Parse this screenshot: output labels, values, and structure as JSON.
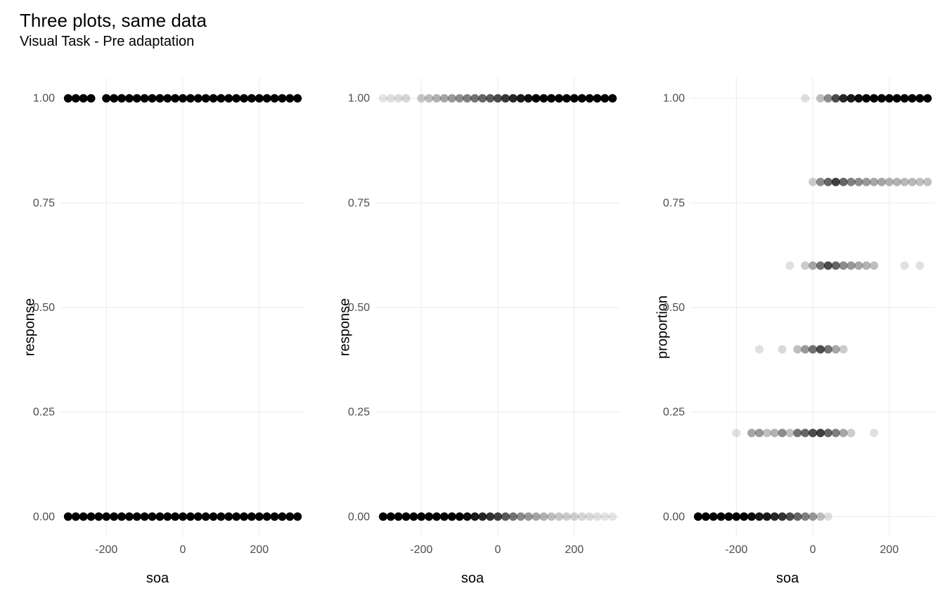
{
  "title": "Three plots, same data",
  "subtitle": "Visual Task - Pre adaptation",
  "chart_data": [
    {
      "type": "scatter",
      "xlabel": "soa",
      "ylabel": "response",
      "xlim": [
        -320,
        320
      ],
      "ylim": [
        -0.05,
        1.05
      ],
      "xticks": [
        -200,
        0,
        200
      ],
      "yticks": [
        0.0,
        0.25,
        0.5,
        0.75,
        1.0
      ],
      "ytick_labels": [
        "0.00",
        "0.25",
        "0.50",
        "0.75",
        "1.00"
      ],
      "opacity_scheme": "solid",
      "points": [
        {
          "x": -300,
          "y": 0
        },
        {
          "x": -280,
          "y": 0
        },
        {
          "x": -260,
          "y": 0
        },
        {
          "x": -240,
          "y": 0
        },
        {
          "x": -220,
          "y": 0
        },
        {
          "x": -200,
          "y": 0
        },
        {
          "x": -180,
          "y": 0
        },
        {
          "x": -160,
          "y": 0
        },
        {
          "x": -140,
          "y": 0
        },
        {
          "x": -120,
          "y": 0
        },
        {
          "x": -100,
          "y": 0
        },
        {
          "x": -80,
          "y": 0
        },
        {
          "x": -60,
          "y": 0
        },
        {
          "x": -40,
          "y": 0
        },
        {
          "x": -20,
          "y": 0
        },
        {
          "x": 0,
          "y": 0
        },
        {
          "x": 20,
          "y": 0
        },
        {
          "x": 40,
          "y": 0
        },
        {
          "x": 60,
          "y": 0
        },
        {
          "x": 80,
          "y": 0
        },
        {
          "x": 100,
          "y": 0
        },
        {
          "x": 120,
          "y": 0
        },
        {
          "x": 140,
          "y": 0
        },
        {
          "x": 160,
          "y": 0
        },
        {
          "x": 180,
          "y": 0
        },
        {
          "x": 200,
          "y": 0
        },
        {
          "x": 220,
          "y": 0
        },
        {
          "x": 240,
          "y": 0
        },
        {
          "x": 260,
          "y": 0
        },
        {
          "x": 280,
          "y": 0
        },
        {
          "x": 300,
          "y": 0
        },
        {
          "x": -300,
          "y": 1
        },
        {
          "x": -280,
          "y": 1
        },
        {
          "x": -260,
          "y": 1
        },
        {
          "x": -240,
          "y": 1
        },
        {
          "x": -200,
          "y": 1
        },
        {
          "x": -180,
          "y": 1
        },
        {
          "x": -160,
          "y": 1
        },
        {
          "x": -140,
          "y": 1
        },
        {
          "x": -120,
          "y": 1
        },
        {
          "x": -100,
          "y": 1
        },
        {
          "x": -80,
          "y": 1
        },
        {
          "x": -60,
          "y": 1
        },
        {
          "x": -40,
          "y": 1
        },
        {
          "x": -20,
          "y": 1
        },
        {
          "x": 0,
          "y": 1
        },
        {
          "x": 20,
          "y": 1
        },
        {
          "x": 40,
          "y": 1
        },
        {
          "x": 60,
          "y": 1
        },
        {
          "x": 80,
          "y": 1
        },
        {
          "x": 100,
          "y": 1
        },
        {
          "x": 120,
          "y": 1
        },
        {
          "x": 140,
          "y": 1
        },
        {
          "x": 160,
          "y": 1
        },
        {
          "x": 180,
          "y": 1
        },
        {
          "x": 200,
          "y": 1
        },
        {
          "x": 220,
          "y": 1
        },
        {
          "x": 240,
          "y": 1
        },
        {
          "x": 260,
          "y": 1
        },
        {
          "x": 280,
          "y": 1
        },
        {
          "x": 300,
          "y": 1
        }
      ]
    },
    {
      "type": "scatter",
      "xlabel": "soa",
      "ylabel": "response",
      "xlim": [
        -320,
        320
      ],
      "ylim": [
        -0.05,
        1.05
      ],
      "xticks": [
        -200,
        0,
        200
      ],
      "yticks": [
        0.0,
        0.25,
        0.5,
        0.75,
        1.0
      ],
      "ytick_labels": [
        "0.00",
        "0.25",
        "0.50",
        "0.75",
        "1.00"
      ],
      "opacity_scheme": "count",
      "points": [
        {
          "x": -300,
          "y": 0,
          "a": 1.0
        },
        {
          "x": -280,
          "y": 0,
          "a": 1.0
        },
        {
          "x": -260,
          "y": 0,
          "a": 1.0
        },
        {
          "x": -240,
          "y": 0,
          "a": 1.0
        },
        {
          "x": -220,
          "y": 0,
          "a": 1.0
        },
        {
          "x": -200,
          "y": 0,
          "a": 1.0
        },
        {
          "x": -180,
          "y": 0,
          "a": 1.0
        },
        {
          "x": -160,
          "y": 0,
          "a": 1.0
        },
        {
          "x": -140,
          "y": 0,
          "a": 1.0
        },
        {
          "x": -120,
          "y": 0,
          "a": 1.0
        },
        {
          "x": -100,
          "y": 0,
          "a": 1.0
        },
        {
          "x": -80,
          "y": 0,
          "a": 0.95
        },
        {
          "x": -60,
          "y": 0,
          "a": 0.9
        },
        {
          "x": -40,
          "y": 0,
          "a": 0.85
        },
        {
          "x": -20,
          "y": 0,
          "a": 0.8
        },
        {
          "x": 0,
          "y": 0,
          "a": 0.75
        },
        {
          "x": 20,
          "y": 0,
          "a": 0.65
        },
        {
          "x": 40,
          "y": 0,
          "a": 0.55
        },
        {
          "x": 60,
          "y": 0,
          "a": 0.45
        },
        {
          "x": 80,
          "y": 0,
          "a": 0.4
        },
        {
          "x": 100,
          "y": 0,
          "a": 0.35
        },
        {
          "x": 120,
          "y": 0,
          "a": 0.3
        },
        {
          "x": 140,
          "y": 0,
          "a": 0.25
        },
        {
          "x": 160,
          "y": 0,
          "a": 0.22
        },
        {
          "x": 180,
          "y": 0,
          "a": 0.2
        },
        {
          "x": 200,
          "y": 0,
          "a": 0.18
        },
        {
          "x": 220,
          "y": 0,
          "a": 0.16
        },
        {
          "x": 240,
          "y": 0,
          "a": 0.14
        },
        {
          "x": 260,
          "y": 0,
          "a": 0.12
        },
        {
          "x": 280,
          "y": 0,
          "a": 0.11
        },
        {
          "x": 300,
          "y": 0,
          "a": 0.1
        },
        {
          "x": -300,
          "y": 1,
          "a": 0.1
        },
        {
          "x": -280,
          "y": 1,
          "a": 0.12
        },
        {
          "x": -260,
          "y": 1,
          "a": 0.14
        },
        {
          "x": -240,
          "y": 1,
          "a": 0.16
        },
        {
          "x": -200,
          "y": 1,
          "a": 0.22
        },
        {
          "x": -180,
          "y": 1,
          "a": 0.26
        },
        {
          "x": -160,
          "y": 1,
          "a": 0.3
        },
        {
          "x": -140,
          "y": 1,
          "a": 0.35
        },
        {
          "x": -120,
          "y": 1,
          "a": 0.4
        },
        {
          "x": -100,
          "y": 1,
          "a": 0.45
        },
        {
          "x": -80,
          "y": 1,
          "a": 0.5
        },
        {
          "x": -60,
          "y": 1,
          "a": 0.55
        },
        {
          "x": -40,
          "y": 1,
          "a": 0.6
        },
        {
          "x": -20,
          "y": 1,
          "a": 0.65
        },
        {
          "x": 0,
          "y": 1,
          "a": 0.7
        },
        {
          "x": 20,
          "y": 1,
          "a": 0.78
        },
        {
          "x": 40,
          "y": 1,
          "a": 0.85
        },
        {
          "x": 60,
          "y": 1,
          "a": 0.9
        },
        {
          "x": 80,
          "y": 1,
          "a": 0.95
        },
        {
          "x": 100,
          "y": 1,
          "a": 1.0
        },
        {
          "x": 120,
          "y": 1,
          "a": 1.0
        },
        {
          "x": 140,
          "y": 1,
          "a": 1.0
        },
        {
          "x": 160,
          "y": 1,
          "a": 1.0
        },
        {
          "x": 180,
          "y": 1,
          "a": 1.0
        },
        {
          "x": 200,
          "y": 1,
          "a": 1.0
        },
        {
          "x": 220,
          "y": 1,
          "a": 1.0
        },
        {
          "x": 240,
          "y": 1,
          "a": 1.0
        },
        {
          "x": 260,
          "y": 1,
          "a": 1.0
        },
        {
          "x": 280,
          "y": 1,
          "a": 1.0
        },
        {
          "x": 300,
          "y": 1,
          "a": 1.0
        }
      ]
    },
    {
      "type": "scatter",
      "xlabel": "soa",
      "ylabel": "proportion",
      "xlim": [
        -320,
        320
      ],
      "ylim": [
        -0.05,
        1.05
      ],
      "xticks": [
        -200,
        0,
        200
      ],
      "yticks": [
        0.0,
        0.25,
        0.5,
        0.75,
        1.0
      ],
      "ytick_labels": [
        "0.00",
        "0.25",
        "0.50",
        "0.75",
        "1.00"
      ],
      "opacity_scheme": "count",
      "points": [
        {
          "x": -300,
          "y": 0.0,
          "a": 1.0
        },
        {
          "x": -280,
          "y": 0.0,
          "a": 1.0
        },
        {
          "x": -260,
          "y": 0.0,
          "a": 1.0
        },
        {
          "x": -240,
          "y": 0.0,
          "a": 1.0
        },
        {
          "x": -220,
          "y": 0.0,
          "a": 1.0
        },
        {
          "x": -200,
          "y": 0.0,
          "a": 1.0
        },
        {
          "x": -180,
          "y": 0.0,
          "a": 1.0
        },
        {
          "x": -160,
          "y": 0.0,
          "a": 0.95
        },
        {
          "x": -140,
          "y": 0.0,
          "a": 0.9
        },
        {
          "x": -120,
          "y": 0.0,
          "a": 0.9
        },
        {
          "x": -100,
          "y": 0.0,
          "a": 0.85
        },
        {
          "x": -80,
          "y": 0.0,
          "a": 0.8
        },
        {
          "x": -60,
          "y": 0.0,
          "a": 0.7
        },
        {
          "x": -40,
          "y": 0.0,
          "a": 0.6
        },
        {
          "x": -20,
          "y": 0.0,
          "a": 0.5
        },
        {
          "x": 0,
          "y": 0.0,
          "a": 0.4
        },
        {
          "x": 20,
          "y": 0.0,
          "a": 0.25
        },
        {
          "x": 40,
          "y": 0.0,
          "a": 0.12
        },
        {
          "x": -200,
          "y": 0.2,
          "a": 0.12
        },
        {
          "x": -160,
          "y": 0.2,
          "a": 0.35
        },
        {
          "x": -140,
          "y": 0.2,
          "a": 0.4
        },
        {
          "x": -120,
          "y": 0.2,
          "a": 0.25
        },
        {
          "x": -100,
          "y": 0.2,
          "a": 0.3
        },
        {
          "x": -80,
          "y": 0.2,
          "a": 0.45
        },
        {
          "x": -60,
          "y": 0.2,
          "a": 0.25
        },
        {
          "x": -40,
          "y": 0.2,
          "a": 0.55
        },
        {
          "x": -20,
          "y": 0.2,
          "a": 0.6
        },
        {
          "x": 0,
          "y": 0.2,
          "a": 0.7
        },
        {
          "x": 20,
          "y": 0.2,
          "a": 0.75
        },
        {
          "x": 40,
          "y": 0.2,
          "a": 0.6
        },
        {
          "x": 60,
          "y": 0.2,
          "a": 0.5
        },
        {
          "x": 80,
          "y": 0.2,
          "a": 0.35
        },
        {
          "x": 100,
          "y": 0.2,
          "a": 0.2
        },
        {
          "x": 160,
          "y": 0.2,
          "a": 0.12
        },
        {
          "x": -140,
          "y": 0.4,
          "a": 0.12
        },
        {
          "x": -80,
          "y": 0.4,
          "a": 0.15
        },
        {
          "x": -40,
          "y": 0.4,
          "a": 0.25
        },
        {
          "x": -20,
          "y": 0.4,
          "a": 0.4
        },
        {
          "x": 0,
          "y": 0.4,
          "a": 0.55
        },
        {
          "x": 20,
          "y": 0.4,
          "a": 0.7
        },
        {
          "x": 40,
          "y": 0.4,
          "a": 0.55
        },
        {
          "x": 60,
          "y": 0.4,
          "a": 0.35
        },
        {
          "x": 80,
          "y": 0.4,
          "a": 0.2
        },
        {
          "x": -60,
          "y": 0.6,
          "a": 0.12
        },
        {
          "x": -20,
          "y": 0.6,
          "a": 0.2
        },
        {
          "x": 0,
          "y": 0.6,
          "a": 0.35
        },
        {
          "x": 20,
          "y": 0.6,
          "a": 0.55
        },
        {
          "x": 40,
          "y": 0.6,
          "a": 0.7
        },
        {
          "x": 60,
          "y": 0.6,
          "a": 0.6
        },
        {
          "x": 80,
          "y": 0.6,
          "a": 0.45
        },
        {
          "x": 100,
          "y": 0.6,
          "a": 0.4
        },
        {
          "x": 120,
          "y": 0.6,
          "a": 0.35
        },
        {
          "x": 140,
          "y": 0.6,
          "a": 0.3
        },
        {
          "x": 160,
          "y": 0.6,
          "a": 0.25
        },
        {
          "x": 240,
          "y": 0.6,
          "a": 0.12
        },
        {
          "x": 280,
          "y": 0.6,
          "a": 0.12
        },
        {
          "x": 0,
          "y": 0.8,
          "a": 0.2
        },
        {
          "x": 20,
          "y": 0.8,
          "a": 0.45
        },
        {
          "x": 40,
          "y": 0.8,
          "a": 0.6
        },
        {
          "x": 60,
          "y": 0.8,
          "a": 0.75
        },
        {
          "x": 80,
          "y": 0.8,
          "a": 0.6
        },
        {
          "x": 100,
          "y": 0.8,
          "a": 0.5
        },
        {
          "x": 120,
          "y": 0.8,
          "a": 0.45
        },
        {
          "x": 140,
          "y": 0.8,
          "a": 0.4
        },
        {
          "x": 160,
          "y": 0.8,
          "a": 0.35
        },
        {
          "x": 180,
          "y": 0.8,
          "a": 0.35
        },
        {
          "x": 200,
          "y": 0.8,
          "a": 0.3
        },
        {
          "x": 220,
          "y": 0.8,
          "a": 0.3
        },
        {
          "x": 240,
          "y": 0.8,
          "a": 0.28
        },
        {
          "x": 260,
          "y": 0.8,
          "a": 0.28
        },
        {
          "x": 280,
          "y": 0.8,
          "a": 0.25
        },
        {
          "x": 300,
          "y": 0.8,
          "a": 0.25
        },
        {
          "x": -20,
          "y": 1.0,
          "a": 0.12
        },
        {
          "x": 20,
          "y": 1.0,
          "a": 0.25
        },
        {
          "x": 40,
          "y": 1.0,
          "a": 0.45
        },
        {
          "x": 60,
          "y": 1.0,
          "a": 0.7
        },
        {
          "x": 80,
          "y": 1.0,
          "a": 0.85
        },
        {
          "x": 100,
          "y": 1.0,
          "a": 0.9
        },
        {
          "x": 120,
          "y": 1.0,
          "a": 0.95
        },
        {
          "x": 140,
          "y": 1.0,
          "a": 1.0
        },
        {
          "x": 160,
          "y": 1.0,
          "a": 1.0
        },
        {
          "x": 180,
          "y": 1.0,
          "a": 1.0
        },
        {
          "x": 200,
          "y": 1.0,
          "a": 1.0
        },
        {
          "x": 220,
          "y": 1.0,
          "a": 1.0
        },
        {
          "x": 240,
          "y": 1.0,
          "a": 1.0
        },
        {
          "x": 260,
          "y": 1.0,
          "a": 1.0
        },
        {
          "x": 280,
          "y": 1.0,
          "a": 1.0
        },
        {
          "x": 300,
          "y": 1.0,
          "a": 1.0
        }
      ]
    }
  ]
}
